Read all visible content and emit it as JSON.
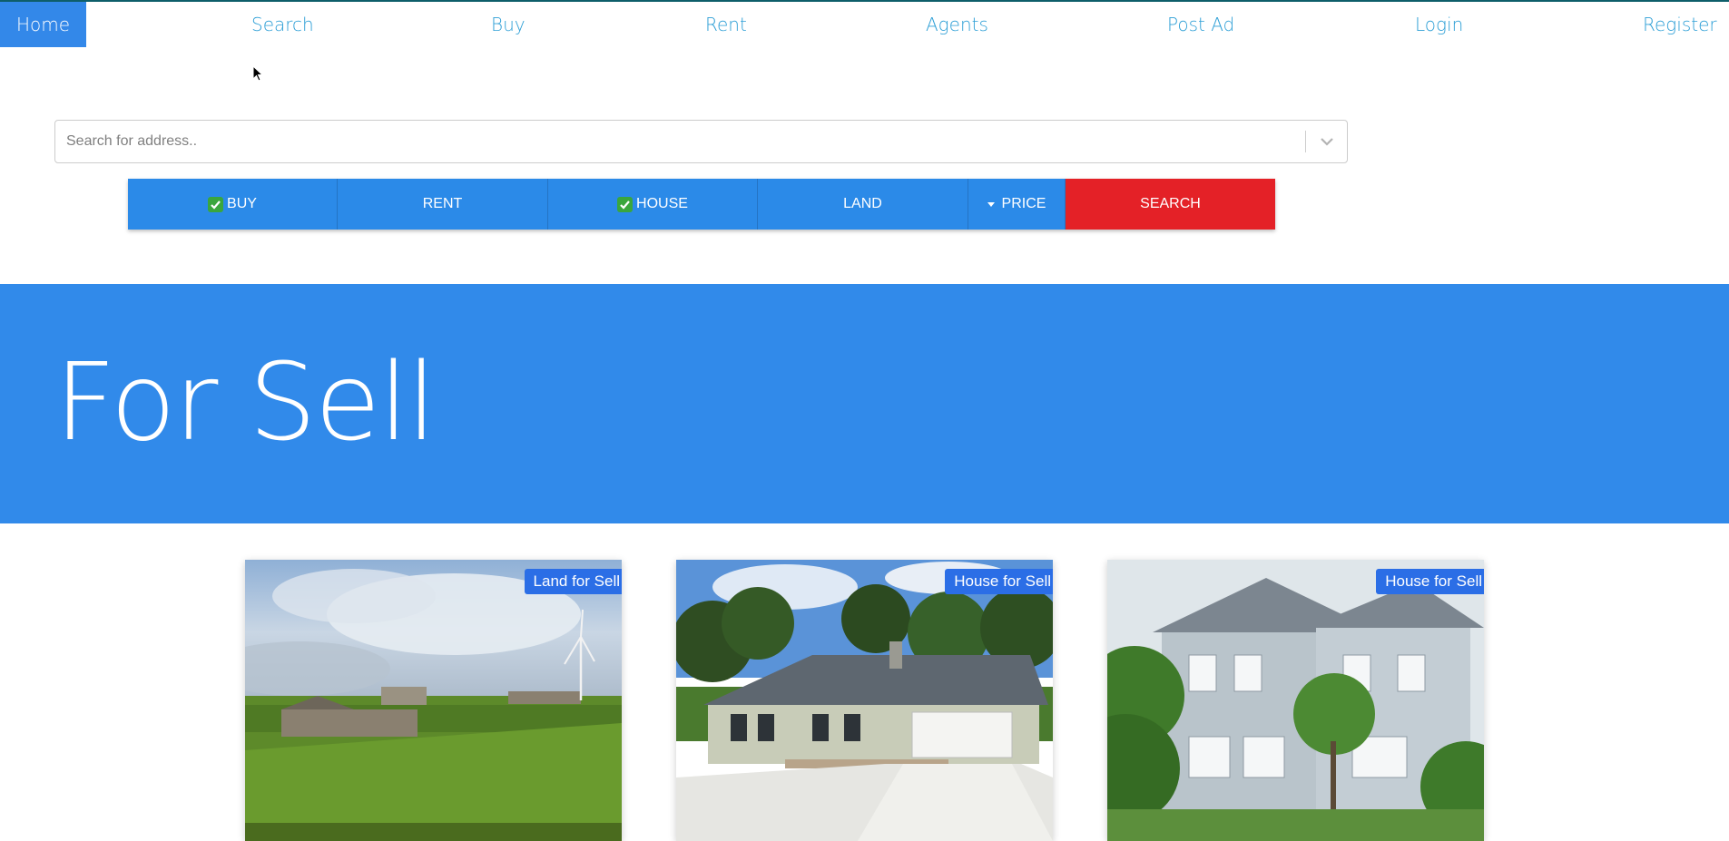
{
  "nav": {
    "items": [
      {
        "label": "Home",
        "active": true
      },
      {
        "label": "Search"
      },
      {
        "label": "Buy"
      },
      {
        "label": "Rent"
      },
      {
        "label": "Agents"
      },
      {
        "label": "Post Ad"
      },
      {
        "label": "Login"
      },
      {
        "label": "Register"
      }
    ]
  },
  "search": {
    "placeholder": "Search for address..",
    "value": ""
  },
  "filters": {
    "buy": {
      "label": "BUY",
      "checked": true
    },
    "rent": {
      "label": "RENT",
      "checked": false
    },
    "house": {
      "label": "HOUSE",
      "checked": true
    },
    "land": {
      "label": "LAND",
      "checked": false
    },
    "price": {
      "label": "PRICE"
    },
    "search": {
      "label": "SEARCH"
    }
  },
  "hero": {
    "title": "For Sell"
  },
  "listings": [
    {
      "badge": "Land for Sell",
      "image": "countryside-windmill"
    },
    {
      "badge": "House for Sell",
      "image": "ranch-house"
    },
    {
      "badge": "House for Sell",
      "image": "grey-two-storey-house"
    }
  ],
  "colors": {
    "accent": "#318aea",
    "nav_text": "#2e9fd6",
    "search_button": "#e42127",
    "check": "#3aa63d",
    "badge": "#2b6ee6"
  }
}
